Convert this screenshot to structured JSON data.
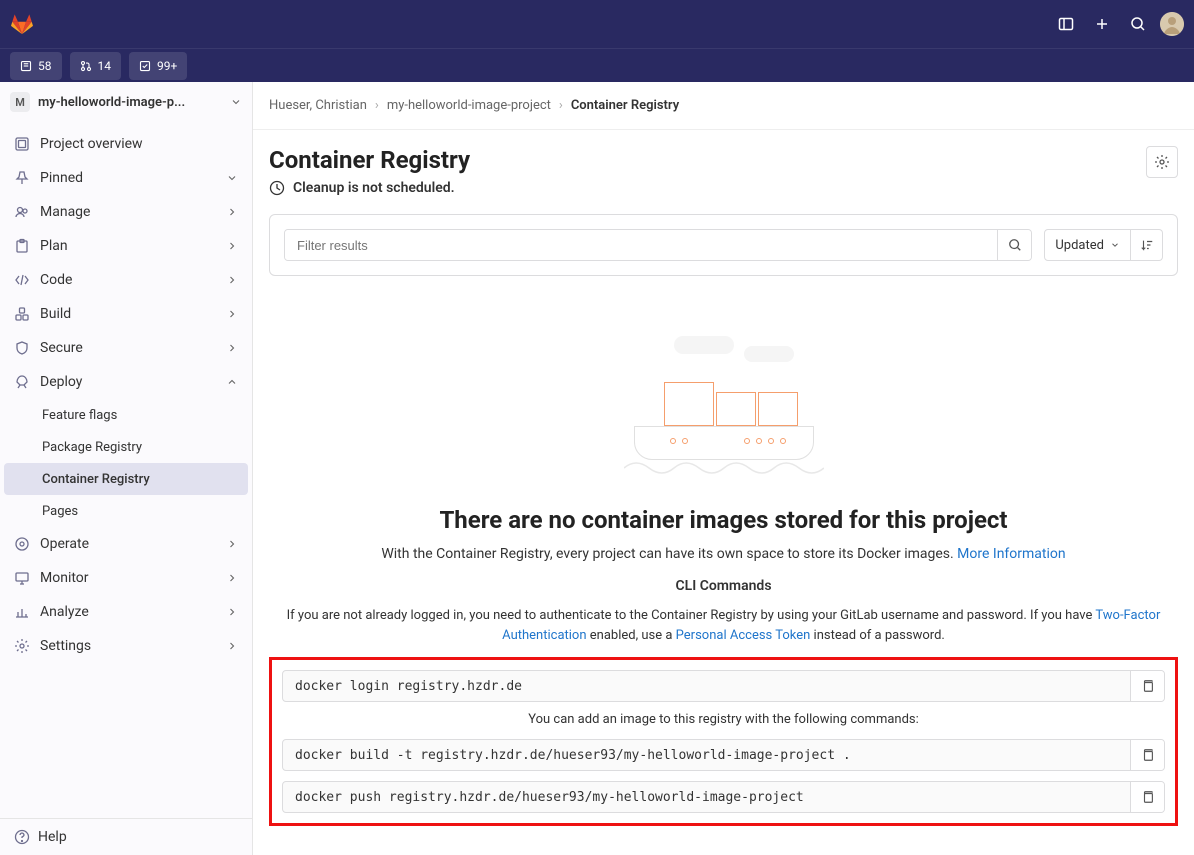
{
  "topbar": {
    "pills": [
      {
        "icon": "doc",
        "count": "58"
      },
      {
        "icon": "merge",
        "count": "14"
      },
      {
        "icon": "todo",
        "count": "99+"
      }
    ]
  },
  "project": {
    "avatar_letter": "M",
    "name": "my-helloworld-image-p..."
  },
  "sidebar": {
    "overview": "Project overview",
    "pinned": "Pinned",
    "manage": "Manage",
    "plan": "Plan",
    "code": "Code",
    "build": "Build",
    "secure": "Secure",
    "deploy": "Deploy",
    "deploy_children": {
      "feature_flags": "Feature flags",
      "package_registry": "Package Registry",
      "container_registry": "Container Registry",
      "pages": "Pages"
    },
    "operate": "Operate",
    "monitor": "Monitor",
    "analyze": "Analyze",
    "settings": "Settings",
    "help": "Help"
  },
  "breadcrumbs": {
    "a": "Hueser, Christian",
    "b": "my-helloworld-image-project",
    "c": "Container Registry"
  },
  "page": {
    "title": "Container Registry",
    "cleanup": "Cleanup is not scheduled."
  },
  "filter": {
    "placeholder": "Filter results",
    "sort_label": "Updated"
  },
  "empty": {
    "title": "There are no container images stored for this project",
    "subtitle_pre": "With the Container Registry, every project can have its own space to store its Docker images. ",
    "more_info": "More Information",
    "cli_title": "CLI Commands",
    "cli_desc_pre": "If you are not already logged in, you need to authenticate to the Container Registry by using your GitLab username and password. If you have ",
    "twofa": "Two-Factor Authentication",
    "cli_desc_mid": " enabled, use a ",
    "pat": "Personal Access Token",
    "cli_desc_post": " instead of a password.",
    "cmd1": "docker login registry.hzdr.de",
    "mid_note": "You can add an image to this registry with the following commands:",
    "cmd2": "docker build -t registry.hzdr.de/hueser93/my-helloworld-image-project .",
    "cmd3": "docker push registry.hzdr.de/hueser93/my-helloworld-image-project"
  }
}
